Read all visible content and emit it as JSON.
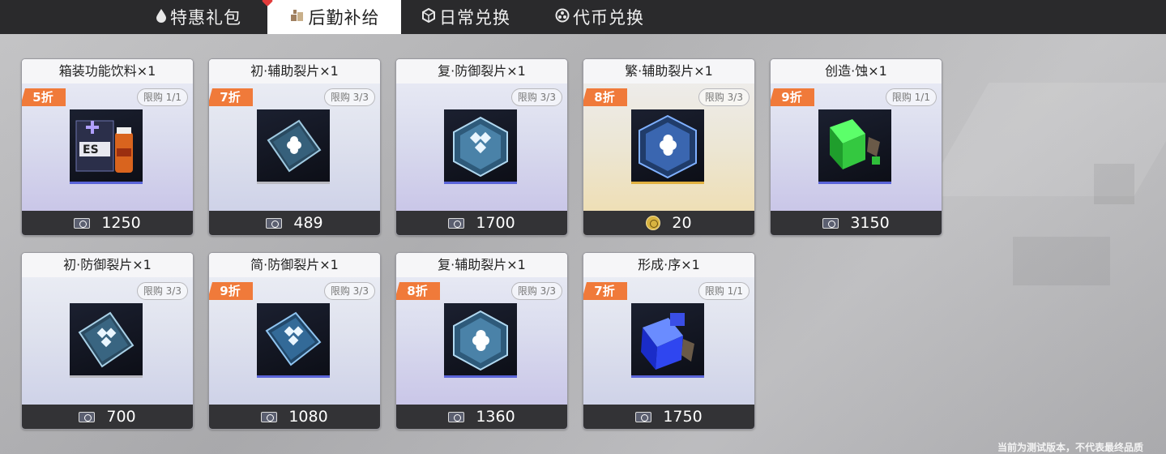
{
  "tabs": [
    {
      "label": "特惠礼包",
      "icon": "drop-icon",
      "active": false
    },
    {
      "label": "后勤补给",
      "icon": "supply-icon",
      "active": true
    },
    {
      "label": "日常兑换",
      "icon": "cube-icon",
      "active": false
    },
    {
      "label": "代币兑换",
      "icon": "token-icon",
      "active": false
    }
  ],
  "items": [
    {
      "title": "箱装功能饮料×1",
      "discount": "5折",
      "limit": "限购 1/1",
      "price": "1250",
      "currency": "credit-icon",
      "theme": "purple",
      "icon": "drink-box-icon"
    },
    {
      "title": "初·辅助裂片×1",
      "discount": "7折",
      "limit": "限购 3/3",
      "price": "489",
      "currency": "credit-icon",
      "theme": "plain",
      "icon": "support-shard-icon"
    },
    {
      "title": "复·防御裂片×1",
      "discount": "",
      "limit": "限购 3/3",
      "price": "1700",
      "currency": "credit-icon",
      "theme": "purple",
      "icon": "defense-shard-icon"
    },
    {
      "title": "繁·辅助裂片×1",
      "discount": "8折",
      "limit": "限购 3/3",
      "price": "20",
      "currency": "gold-token-icon",
      "theme": "gold",
      "icon": "support-shard-icon"
    },
    {
      "title": "创造·蚀×1",
      "discount": "9折",
      "limit": "限购 1/1",
      "price": "3150",
      "currency": "credit-icon",
      "theme": "purple",
      "icon": "green-cube-icon"
    },
    {
      "title": "初·防御裂片×1",
      "discount": "",
      "limit": "限购 3/3",
      "price": "700",
      "currency": "credit-icon",
      "theme": "plain",
      "icon": "defense-shard-icon"
    },
    {
      "title": "简·防御裂片×1",
      "discount": "9折",
      "limit": "限购 3/3",
      "price": "1080",
      "currency": "credit-icon",
      "theme": "blue",
      "icon": "defense-shard-icon"
    },
    {
      "title": "复·辅助裂片×1",
      "discount": "8折",
      "limit": "限购 3/3",
      "price": "1360",
      "currency": "credit-icon",
      "theme": "purple",
      "icon": "support-shard-icon"
    },
    {
      "title": "形成·序×1",
      "discount": "7折",
      "limit": "限购 1/1",
      "price": "1750",
      "currency": "credit-icon",
      "theme": "blue",
      "icon": "blue-cube-icon"
    }
  ],
  "footnote": "当前为测试版本，不代表最终品质"
}
